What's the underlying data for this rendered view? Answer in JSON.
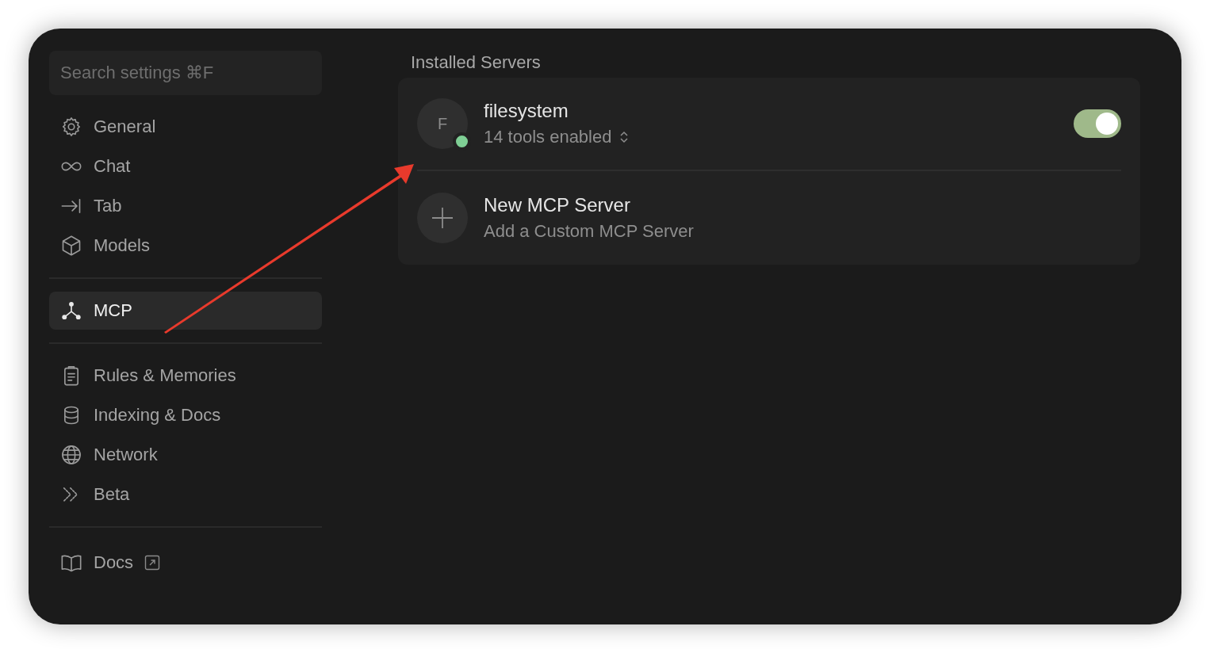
{
  "sidebar": {
    "search": {
      "placeholder": "Search settings ⌘F"
    },
    "groups": [
      [
        {
          "label": "General",
          "selected": false
        },
        {
          "label": "Chat",
          "selected": false
        },
        {
          "label": "Tab",
          "selected": false
        },
        {
          "label": "Models",
          "selected": false
        }
      ],
      [
        {
          "label": "MCP",
          "selected": true
        }
      ],
      [
        {
          "label": "Rules & Memories",
          "selected": false
        },
        {
          "label": "Indexing & Docs",
          "selected": false
        },
        {
          "label": "Network",
          "selected": false
        },
        {
          "label": "Beta",
          "selected": false
        }
      ]
    ],
    "footer_link": {
      "label": "Docs"
    }
  },
  "main": {
    "section_title": "Installed Servers",
    "servers": [
      {
        "avatar": "F",
        "name": "filesystem",
        "tools": "14 tools enabled",
        "color": "#7fcf95",
        "on": true
      }
    ],
    "add_server": {
      "title": "New MCP Server",
      "subtitle": "Add a Custom MCP Server"
    }
  }
}
